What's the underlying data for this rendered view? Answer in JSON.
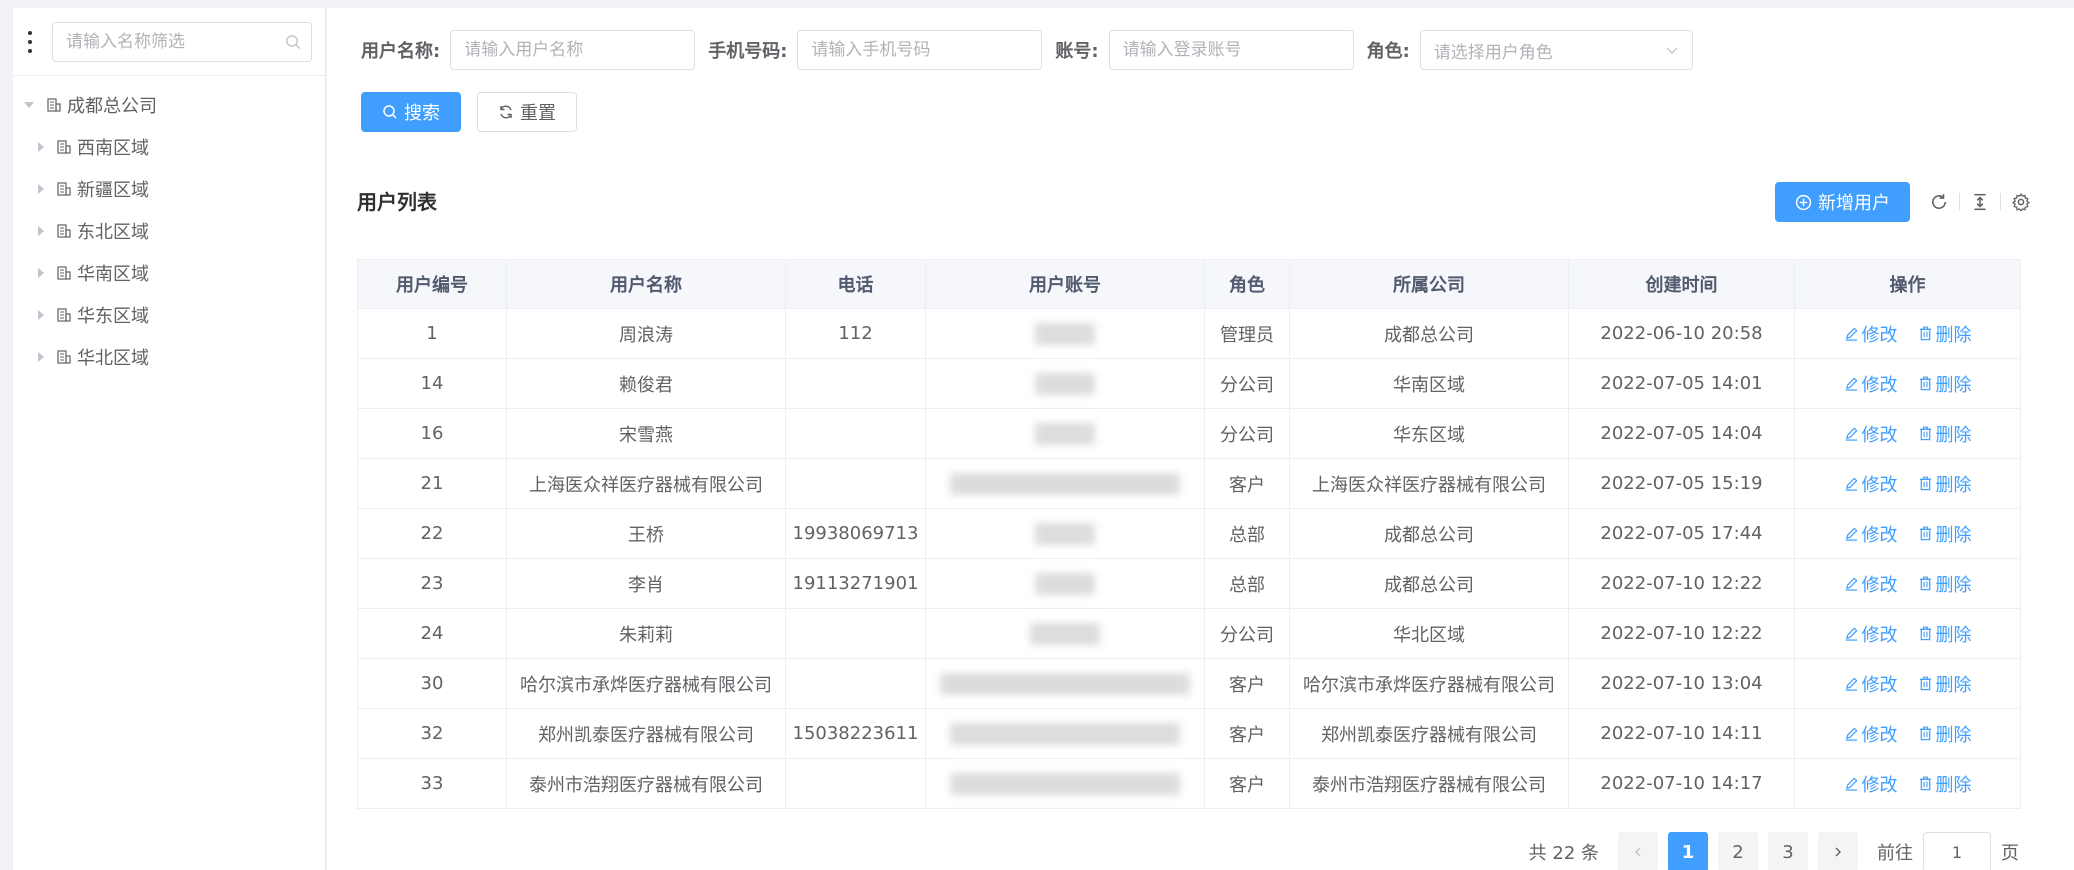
{
  "sidebar": {
    "filter_placeholder": "请输入名称筛选",
    "tree": {
      "root": "成都总公司",
      "children": [
        "西南区域",
        "新疆区域",
        "东北区域",
        "华南区域",
        "华东区域",
        "华北区域"
      ]
    }
  },
  "search": {
    "username_label": "用户名称:",
    "username_placeholder": "请输入用户名称",
    "phone_label": "手机号码:",
    "phone_placeholder": "请输入手机号码",
    "account_label": "账号:",
    "account_placeholder": "请输入登录账号",
    "role_label": "角色:",
    "role_placeholder": "请选择用户角色",
    "search_button": "搜索",
    "reset_button": "重置"
  },
  "list": {
    "title": "用户列表",
    "add_button": "新增用户"
  },
  "table": {
    "headers": [
      "用户编号",
      "用户名称",
      "电话",
      "用户账号",
      "角色",
      "所属公司",
      "创建时间",
      "操作"
    ],
    "edit_label": "修改",
    "delete_label": "删除",
    "rows": [
      {
        "id": "1",
        "name": "周浪涛",
        "phone": "112",
        "role": "管理员",
        "company": "成都总公司",
        "created": "2022-06-10 20:58"
      },
      {
        "id": "14",
        "name": "赖俊君",
        "phone": "",
        "role": "分公司",
        "company": "华南区域",
        "created": "2022-07-05 14:01"
      },
      {
        "id": "16",
        "name": "宋雪燕",
        "phone": "",
        "role": "分公司",
        "company": "华东区域",
        "created": "2022-07-05 14:04"
      },
      {
        "id": "21",
        "name": "上海医众祥医疗器械有限公司",
        "phone": "",
        "role": "客户",
        "company": "上海医众祥医疗器械有限公司",
        "created": "2022-07-05 15:19"
      },
      {
        "id": "22",
        "name": "王桥",
        "phone": "19938069713",
        "role": "总部",
        "company": "成都总公司",
        "created": "2022-07-05 17:44"
      },
      {
        "id": "23",
        "name": "李肖",
        "phone": "19113271901",
        "role": "总部",
        "company": "成都总公司",
        "created": "2022-07-10 12:22"
      },
      {
        "id": "24",
        "name": "朱莉莉",
        "phone": "",
        "role": "分公司",
        "company": "华北区域",
        "created": "2022-07-10 12:22"
      },
      {
        "id": "30",
        "name": "哈尔滨市承烨医疗器械有限公司",
        "phone": "",
        "role": "客户",
        "company": "哈尔滨市承烨医疗器械有限公司",
        "created": "2022-07-10 13:04"
      },
      {
        "id": "32",
        "name": "郑州凯泰医疗器械有限公司",
        "phone": "15038223611",
        "role": "客户",
        "company": "郑州凯泰医疗器械有限公司",
        "created": "2022-07-10 14:11"
      },
      {
        "id": "33",
        "name": "泰州市浩翔医疗器械有限公司",
        "phone": "",
        "role": "客户",
        "company": "泰州市浩翔医疗器械有限公司",
        "created": "2022-07-10 14:17"
      }
    ]
  },
  "pagination": {
    "total_text": "共 22 条",
    "pages": [
      "1",
      "2",
      "3"
    ],
    "current": "1",
    "goto_label": "前往",
    "goto_value": "1",
    "page_suffix": "页"
  },
  "colors": {
    "primary": "#409eff",
    "header_bg": "#f5f7fa",
    "border": "#ebeef5"
  }
}
